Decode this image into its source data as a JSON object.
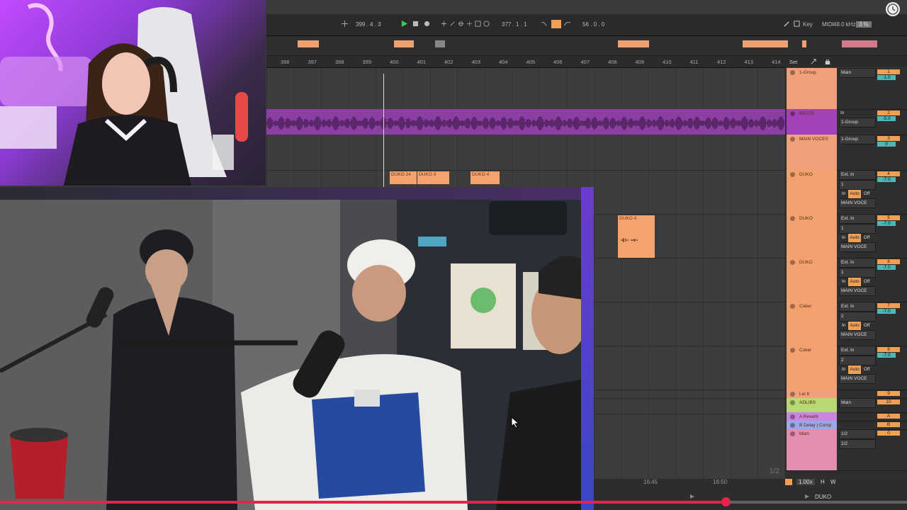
{
  "transport": {
    "position": "399 .  4 .  3",
    "loop_start": "377 .  1 .  1",
    "loop_length": "56 .  0 .  0",
    "key_label": "Key",
    "midi_label": "MIDI",
    "sample_rate": "48.0 kHz",
    "cpu": "3 %"
  },
  "ruler": {
    "bars": [
      "396",
      "397",
      "398",
      "399",
      "400",
      "401",
      "402",
      "403",
      "404",
      "405",
      "406",
      "407",
      "408",
      "409",
      "410",
      "411",
      "412",
      "413",
      "414"
    ],
    "set_label": "Set"
  },
  "clips": [
    {
      "label": "DUKO 24"
    },
    {
      "label": "DUKO 3"
    },
    {
      "label": "DUKO 4"
    },
    {
      "label": "DUKO 4"
    }
  ],
  "tracks": [
    {
      "name": "1-Group",
      "color": "#f0a07a",
      "out": "Main",
      "num": "1",
      "vol": "-1.0"
    },
    {
      "name": "BEATS",
      "color": "#a342b8",
      "out": "1-Group",
      "in": "In",
      "num": "2",
      "vol": "-5.0"
    },
    {
      "name": "MAIN VOCES",
      "color": "#f0a07a",
      "out": "1-Group",
      "num": "3",
      "vol": "0"
    },
    {
      "name": "DUKO",
      "color": "#f2a26f",
      "input": "Ext. In",
      "ch": "1",
      "monitor": [
        "In",
        "Auto",
        "Off"
      ],
      "out": "MAIN VOCE",
      "num": "4",
      "vol": "-7.0"
    },
    {
      "name": "DUKO",
      "color": "#f2a26f",
      "input": "Ext. In",
      "ch": "1",
      "monitor": [
        "In",
        "Auto",
        "Off"
      ],
      "out": "MAIN VOCE",
      "num": "5",
      "vol": "-7.0"
    },
    {
      "name": "DUKO",
      "color": "#f2a26f",
      "input": "Ext. In",
      "ch": "1",
      "monitor": [
        "In",
        "Auto",
        "Off"
      ],
      "out": "MAIN VOCE",
      "num": "6",
      "vol": "-7.0"
    },
    {
      "name": "Coker",
      "color": "#f2a26f",
      "input": "Ext. In",
      "ch": "2",
      "monitor": [
        "In",
        "Auto",
        "Off"
      ],
      "out": "MAIN VOCE",
      "num": "7",
      "vol": "-7.0"
    },
    {
      "name": "Coker",
      "color": "#f2a26f",
      "input": "Ext. In",
      "ch": "2",
      "monitor": [
        "In",
        "Auto",
        "Off"
      ],
      "out": "MAIN VOCE",
      "num": "8",
      "vol": "-7.0"
    },
    {
      "name": "Lei 8",
      "color": "#f0a07a",
      "num": "9"
    },
    {
      "name": "ADLIBS",
      "color": "#b8d873",
      "out": "Main",
      "num": "10"
    },
    {
      "name": "A Reverb",
      "color": "#c985e0",
      "num": "A"
    },
    {
      "name": "B Delay | Comp",
      "color": "#9aa8e8",
      "num": "B"
    },
    {
      "name": "Main",
      "color": "#e48db0",
      "out1": "1/2",
      "out2": "1/2",
      "num": "0"
    }
  ],
  "statusbar": {
    "time1": "16:45",
    "time2": "16:50",
    "zoom": "1.00x",
    "h_label": "H",
    "w_label": "W",
    "track_name": "DUKO"
  },
  "page_counter": "1/2",
  "video": {
    "progress": 0.8
  }
}
